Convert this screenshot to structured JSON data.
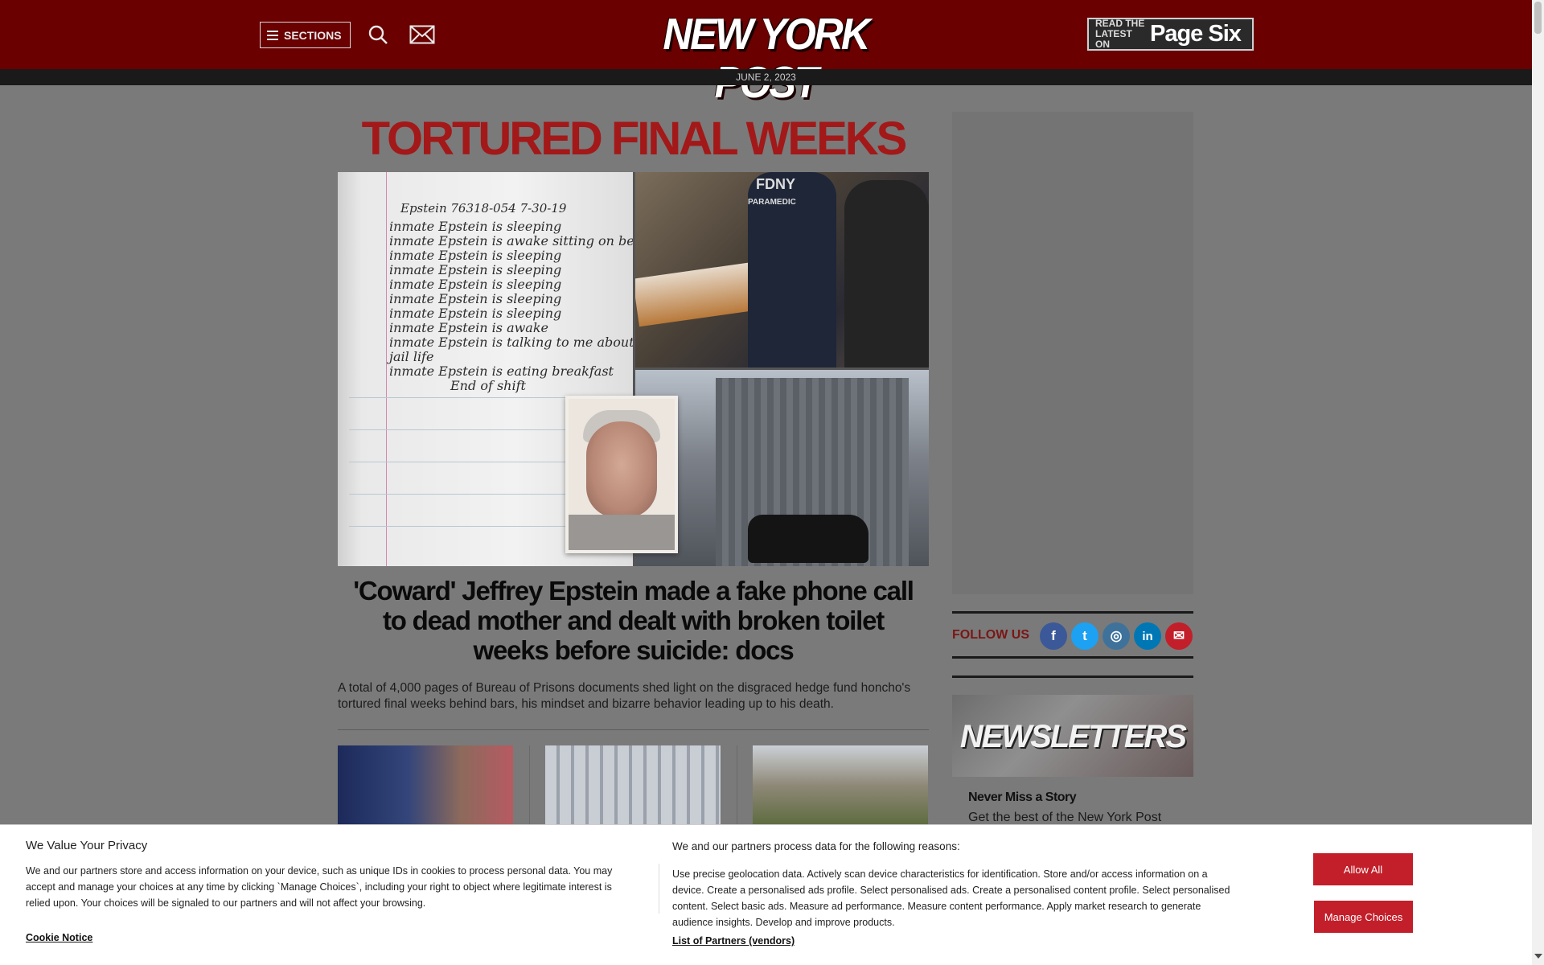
{
  "header": {
    "sections_label": "SECTIONS",
    "logo_text": "NEW YORK POST",
    "pagesix_small": "READ THE LATEST ON",
    "pagesix_big": "Page Six",
    "date": "JUNE 2, 2023"
  },
  "article": {
    "kicker": "TORTURED FINAL WEEKS",
    "headline": "'Coward' Jeffrey Epstein made a fake phone call to dead mother and dealt with broken toilet weeks before suicide: docs",
    "dek": "A total of 4,000 pages of Bureau of Prisons documents shed light on the disgraced hedge fund honcho's tortured final weeks behind bars, his mindset and bizarre behavior leading up to his death.",
    "notebook_header": "Epstein 76318-054      7-30-19",
    "notebook_lines": [
      "inmate Epstein is sleeping",
      "inmate Epstein is awake sitting on bed",
      "inmate Epstein is sleeping",
      "inmate Epstein is sleeping",
      "inmate Epstein is sleeping",
      "inmate Epstein is sleeping",
      "inmate Epstein is sleeping",
      "inmate Epstein is awake",
      "inmate Epstein is talking to me about",
      "jail life",
      "inmate Epstein is eating breakfast",
      "End of shift"
    ],
    "photo_text_fdny": "FDNY",
    "photo_text_paramedic": "PARAMEDIC"
  },
  "sidebar": {
    "follow_label": "FOLLOW US",
    "social_icons": [
      "facebook-icon",
      "twitter-icon",
      "instagram-icon",
      "linkedin-icon",
      "email-icon"
    ],
    "social_glyphs": [
      "f",
      "t",
      "◎",
      "in",
      "✉"
    ],
    "social_colors": [
      "#3b5998",
      "#1da1f2",
      "#3f729b",
      "#0077b5",
      "#c21f2a"
    ],
    "newsletter_title": "NEWSLETTERS",
    "newsletter_head": "Never Miss a Story",
    "newsletter_sub": "Get the best of the New York Post"
  },
  "cookie": {
    "title": "We Value Your Privacy",
    "body": "We and our partners store and access information on your device, such as unique IDs in cookies to process personal data. You may accept and manage your choices at any time by clicking `Manage Choices`, including your right to object where legitimate interest is relied upon. Your choices will be signaled to our partners and will not affect your browsing.",
    "notice_link": "Cookie Notice",
    "purpose_title": "We and our partners process data for the following reasons:",
    "purposes": "Use precise geolocation data. Actively scan device characteristics for identification. Store and/or access information on a device. Create a personalised ads profile. Select personalised ads. Create a personalised content profile. Select personalised content. Select basic ads. Measure ad performance. Measure content performance. Apply market research to generate audience insights. Develop and improve products.",
    "vendors_link": "List of Partners (vendors)",
    "allow_all": "Allow All",
    "manage_choices": "Manage Choices"
  },
  "colors": {
    "brand_red": "#6a0000",
    "kicker_red": "#a31818",
    "button_red": "#c21f2a"
  }
}
